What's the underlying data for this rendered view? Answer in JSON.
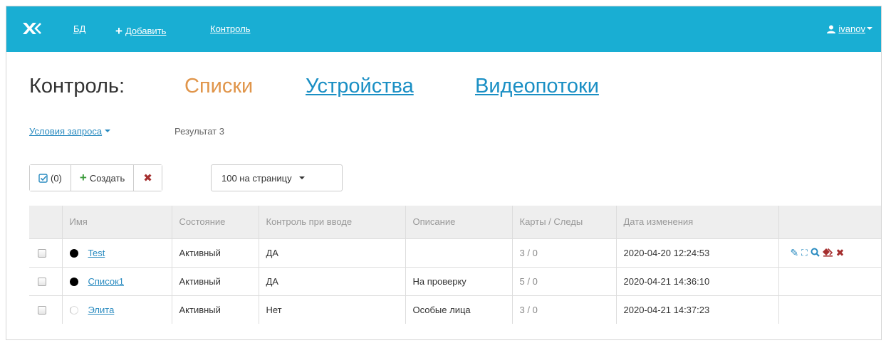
{
  "navbar": {
    "bd_label": "БД",
    "add_label": "Добавить",
    "control_label": "Контроль",
    "user": "ivanov"
  },
  "heading": {
    "title": "Контроль:",
    "lists": "Списки",
    "devices": "Устройства",
    "streams": "Видеопотоки"
  },
  "filters": {
    "conditions_label": "Условия запроса",
    "result_label": "Результат 3"
  },
  "toolbar": {
    "selected_count": "(0)",
    "create_label": "Создать",
    "delete_glyph": "✖",
    "per_page": "100 на страницу"
  },
  "table": {
    "columns": [
      "Имя",
      "Состояние",
      "Контроль при вводе",
      "Описание",
      "Карты / Следы",
      "Дата изменения"
    ],
    "rows": [
      {
        "name": "Test",
        "state": "Активный",
        "control": "ДА",
        "description": "",
        "cards": "3 / 0",
        "date": "2020-04-20 12:24:53",
        "dot": "black"
      },
      {
        "name": "Список1",
        "state": "Активный",
        "control": "ДА",
        "description": "На проверку",
        "cards": "5 / 0",
        "date": "2020-04-21 14:36:10",
        "dot": "black"
      },
      {
        "name": "Элита",
        "state": "Активный",
        "control": "Нет",
        "description": "Особые лица",
        "cards": "3 / 0",
        "date": "2020-04-21 14:37:23",
        "dot": "white"
      }
    ]
  },
  "icons": {
    "row_actions": [
      "pencil-icon",
      "move-icon",
      "search-icon",
      "eraser-icon",
      "remove-icon"
    ]
  },
  "colors": {
    "navbar": "#19aed3",
    "lists_active": "#e0954a",
    "link": "#2a8bc0",
    "danger": "#a52f2f"
  }
}
